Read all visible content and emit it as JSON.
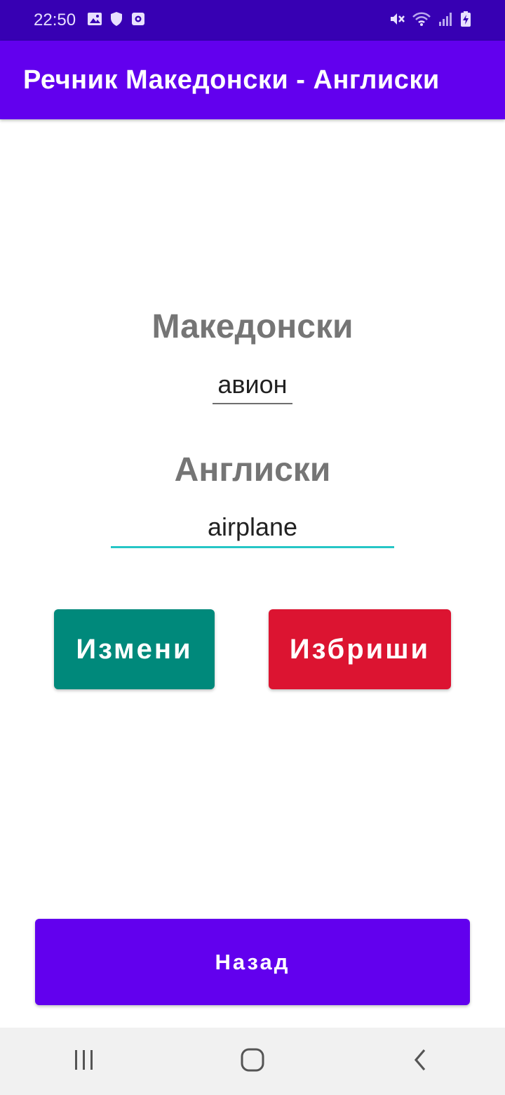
{
  "status_bar": {
    "time": "22:50",
    "left_icons": [
      "gallery-icon",
      "shield-icon",
      "screen-record-icon"
    ],
    "right_icons": [
      "mute-icon",
      "wifi-icon",
      "signal-icon",
      "battery-charging-icon"
    ]
  },
  "app_bar": {
    "title": "Речник Македонски - Англиски"
  },
  "form": {
    "macedonian_label": "Македонски",
    "macedonian_value": "авион",
    "english_label": "Англиски",
    "english_value": "airplane"
  },
  "actions": {
    "edit_label": "Измени",
    "delete_label": "Избриши",
    "back_label": "Назад"
  },
  "colors": {
    "status_bar": "#3700B3",
    "app_bar": "#6200EE",
    "edit_button": "#00897B",
    "delete_button": "#DC1431",
    "back_button": "#6200EE",
    "focused_underline": "#26C6C6"
  },
  "nav_bar": {
    "buttons": [
      "recent-apps-icon",
      "home-icon",
      "back-icon"
    ]
  }
}
